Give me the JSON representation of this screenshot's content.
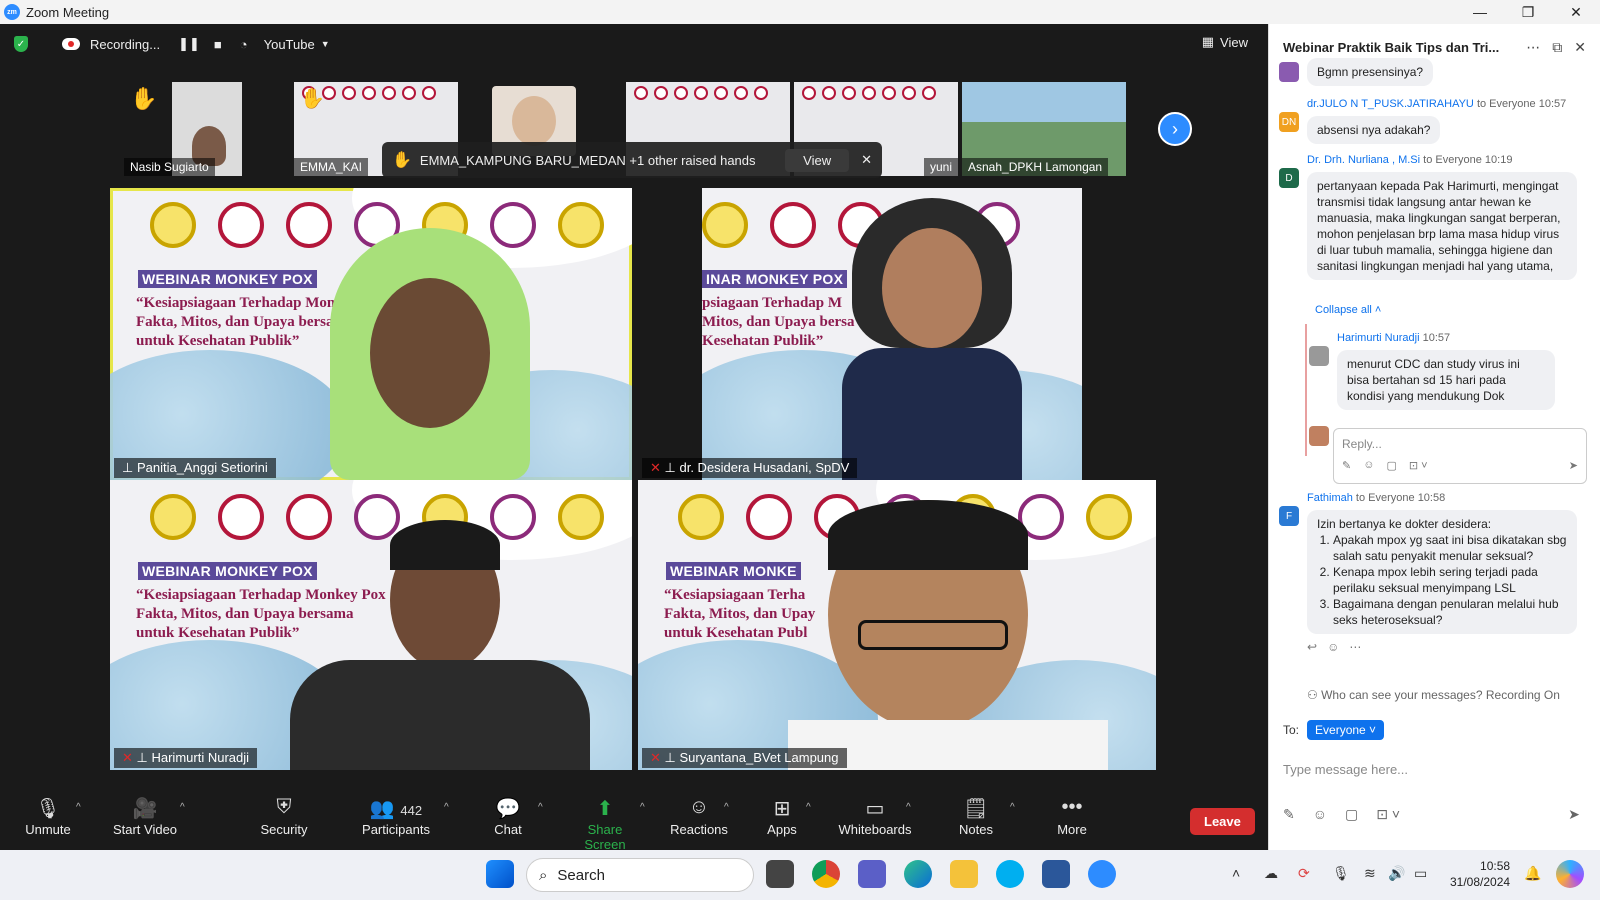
{
  "window": {
    "title": "Zoom Meeting",
    "minimize": "—",
    "restore": "❐",
    "close": "✕"
  },
  "topbar": {
    "recording_label": "Recording...",
    "live_label": "YouTube",
    "view_label": "View"
  },
  "thumbnails": [
    {
      "name": "Nasib Sugiarto"
    },
    {
      "name": "EMMA_KAI"
    },
    {
      "name": ""
    },
    {
      "name": ""
    },
    {
      "name": "yuni"
    },
    {
      "name": "Asnah_DPKH Lamongan"
    }
  ],
  "raised_hands": {
    "text": "EMMA_KAMPUNG BARU_MEDAN +1 other raised hands",
    "view_label": "View"
  },
  "slide": {
    "banner": "WEBINAR MONKEY POX",
    "quote_line1": "“Kesiapsiagaan Terhadap Monkey Pox",
    "quote_line2": "Fakta, Mitos, dan Upaya bersama",
    "quote_line3": "untuk Kesehatan Publik”"
  },
  "tiles": [
    {
      "name": "Panitia_Anggi Setiorini"
    },
    {
      "name": "dr. Desidera Husadani, SpDV"
    },
    {
      "name": "Harimurti Nuradji"
    },
    {
      "name": "Suryantana_BVet Lampung"
    }
  ],
  "toolbar": {
    "unmute": "Unmute",
    "start_video": "Start Video",
    "security": "Security",
    "participants": "Participants",
    "participants_count": "442",
    "chat": "Chat",
    "share_screen": "Share Screen",
    "reactions": "Reactions",
    "apps": "Apps",
    "whiteboards": "Whiteboards",
    "notes": "Notes",
    "more": "More",
    "leave": "Leave"
  },
  "chat": {
    "title": "Webinar Praktik Baik Tips dan Tri...",
    "messages": [
      {
        "text": "Bgmn presensinya?"
      },
      {
        "sender": "dr.JULO N T_PUSK.JATIRAHAYU",
        "to": "to Everyone",
        "time": "10:57",
        "initials": "DN",
        "text": "absensi nya adakah?"
      },
      {
        "sender": "Dr. Drh. Nurliana , M.Si",
        "to": "to Everyone",
        "time": "10:19",
        "initials": "D",
        "text": "pertanyaan kepada Pak Harimurti, mengingat transmisi tidak langsung antar hewan ke manuasia, maka lingkungan sangat berperan, mohon penjelasan brp lama masa hidup virus di luar tubuh mamalia, sehingga higiene dan sanitasi lingkungan menjadi hal yang utama,"
      },
      {
        "sender": "Fathimah",
        "to": "to Everyone",
        "time": "10:58",
        "initials": "F",
        "intro": "Izin bertanya ke dokter desidera:",
        "items": [
          "Apakah mpox yg saat ini bisa dikatakan sbg salah satu penyakit menular seksual?",
          "Kenapa mpox lebih sering terjadi pada perilaku seksual menyimpang LSL",
          "Bagaimana dengan penularan melalui hub seks heteroseksual?"
        ]
      }
    ],
    "collapse_all": "Collapse all",
    "reply": {
      "sender": "Harimurti Nuradji",
      "time": "10:57",
      "text": "menurut CDC dan study virus ini bisa bertahan sd 15 hari pada kondisi yang mendukung Dok"
    },
    "reply_placeholder": "Reply...",
    "who_can_see": "Who can see your messages? Recording On",
    "to_label": "To:",
    "to_value": "Everyone",
    "type_placeholder": "Type message here..."
  },
  "taskbar": {
    "search": "Search",
    "time": "10:58",
    "date": "31/08/2024"
  }
}
